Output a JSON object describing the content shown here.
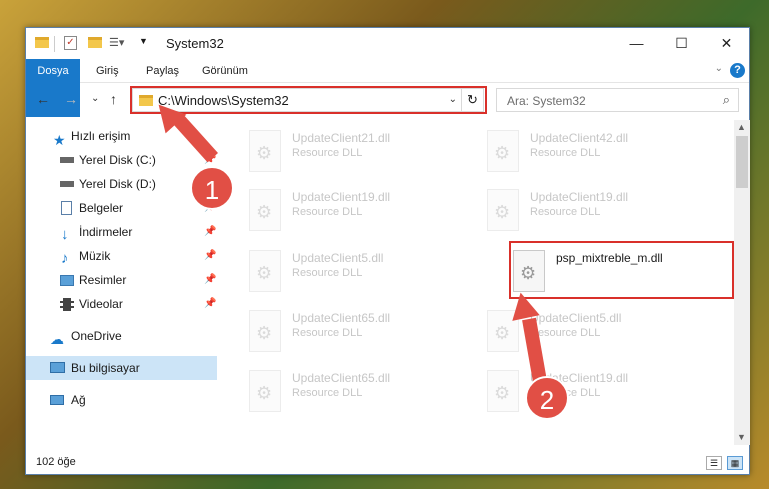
{
  "window": {
    "title": "System32",
    "controls": {
      "minimize": "—",
      "maximize": "☐",
      "close": "✕"
    }
  },
  "ribbon": {
    "tabs": [
      "Dosya",
      "Giriş",
      "Paylaş",
      "Görünüm"
    ],
    "help": "?"
  },
  "navigation": {
    "back": "←",
    "forward": "→",
    "recent": "⌄",
    "up": "↑",
    "address": "C:\\Windows\\System32",
    "refresh": "↻",
    "search_placeholder": "Ara: System32"
  },
  "sidebar": {
    "items": [
      {
        "label": "Hızlı erişim",
        "icon": "star-icon"
      },
      {
        "label": "Yerel Disk (C:)",
        "icon": "drive-icon"
      },
      {
        "label": "Yerel Disk (D:)",
        "icon": "drive-icon"
      },
      {
        "label": "Belgeler",
        "icon": "documents-icon"
      },
      {
        "label": "İndirmeler",
        "icon": "download-icon"
      },
      {
        "label": "Müzik",
        "icon": "music-icon"
      },
      {
        "label": "Resimler",
        "icon": "pictures-icon"
      },
      {
        "label": "Videolar",
        "icon": "video-icon"
      },
      {
        "label": "OneDrive",
        "icon": "cloud-icon"
      },
      {
        "label": "Bu bilgisayar",
        "icon": "computer-icon"
      },
      {
        "label": "Ağ",
        "icon": "network-icon"
      }
    ]
  },
  "files": [
    {
      "name": "UpdateClient21.dll",
      "desc": "Resource DLL"
    },
    {
      "name": "UpdateClient42.dll",
      "desc": "Resource DLL"
    },
    {
      "name": "UpdateClient19.dll",
      "desc": "Resource DLL"
    },
    {
      "name": "UpdateClient19.dll",
      "desc": "Resource DLL"
    },
    {
      "name": "UpdateClient5.dll",
      "desc": "Resource DLL"
    },
    {
      "name": "psp_mixtreble_m.dll",
      "desc": ""
    },
    {
      "name": "UpdateClient65.dll",
      "desc": "Resource DLL"
    },
    {
      "name": "UpdateClient5.dll",
      "desc": "Resource DLL"
    },
    {
      "name": "UpdateClient65.dll",
      "desc": "Resource DLL"
    },
    {
      "name": "UpdateClient19.dll",
      "desc": "Resource DLL"
    }
  ],
  "status": {
    "count": "102 öğe"
  },
  "annotations": {
    "step1": "1",
    "step2": "2"
  },
  "colors": {
    "accent": "#1979ca",
    "highlight": "#d9302a",
    "arrow": "#e14f45"
  }
}
